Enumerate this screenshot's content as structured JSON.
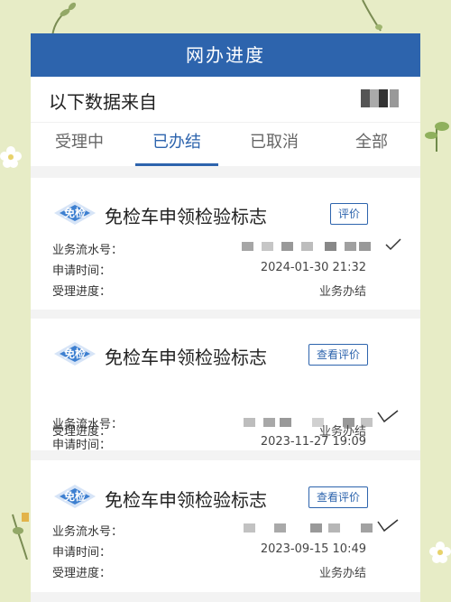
{
  "header": {
    "title": "网办进度"
  },
  "source": {
    "label": "以下数据来自"
  },
  "tabs": [
    {
      "label": "受理中",
      "active": false
    },
    {
      "label": "已办结",
      "active": true
    },
    {
      "label": "已取消",
      "active": false
    },
    {
      "label": "全部",
      "active": false
    }
  ],
  "labels": {
    "serial": "业务流水号：",
    "apply_time": "申请时间：",
    "progress": "受理进度："
  },
  "records": [
    {
      "badge": "免检",
      "title": "免检车申领检验标志",
      "action": "评价",
      "apply_time": "2024-01-30 21:32",
      "progress": "业务办结"
    },
    {
      "badge": "免检",
      "title": "免检车申领检验标志",
      "action": "查看评价",
      "apply_time": "2023-11-27 19:09",
      "progress": "业务办结"
    },
    {
      "badge": "免检",
      "title": "免检车申领检验标志",
      "action": "查看评价",
      "apply_time": "2023-09-15 10:49",
      "progress": "业务办结"
    }
  ],
  "colors": {
    "primary": "#2d64ad",
    "background": "#e7ecc6",
    "badge": "#3d7fd0"
  },
  "icons": [
    "check-icon",
    "badge-diamond-icon",
    "flower-icon",
    "leaf-icon"
  ]
}
